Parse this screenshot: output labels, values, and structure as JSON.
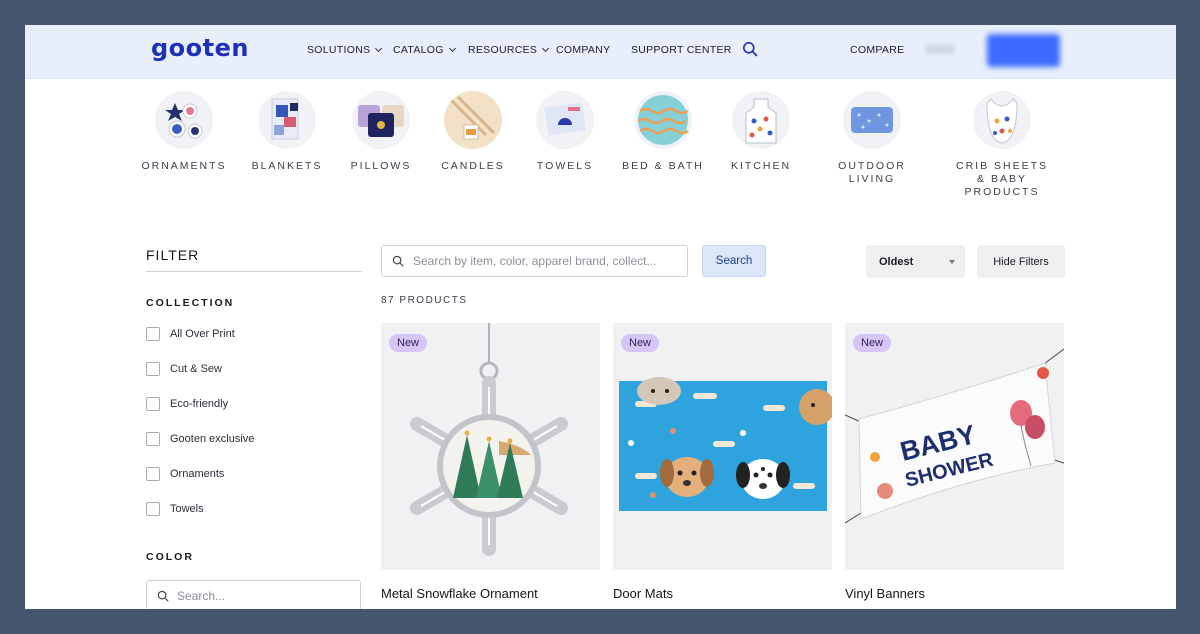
{
  "header": {
    "logo": "gooten",
    "nav": [
      {
        "label": "SOLUTIONS",
        "has_dropdown": true
      },
      {
        "label": "CATALOG",
        "has_dropdown": true
      },
      {
        "label": "RESOURCES",
        "has_dropdown": true
      },
      {
        "label": "COMPANY",
        "has_dropdown": false
      },
      {
        "label": "SUPPORT CENTER",
        "has_dropdown": false
      }
    ],
    "compare_label": "COMPARE",
    "search_icon": "search-icon"
  },
  "categories": [
    {
      "label": "ORNAMENTS"
    },
    {
      "label": "BLANKETS"
    },
    {
      "label": "PILLOWS"
    },
    {
      "label": "CANDLES"
    },
    {
      "label": "TOWELS"
    },
    {
      "label": "BED & BATH"
    },
    {
      "label": "KITCHEN"
    },
    {
      "label": "OUTDOOR LIVING"
    },
    {
      "label": "CRIB SHEETS & BABY PRODUCTS"
    }
  ],
  "filter": {
    "title": "FILTER",
    "collection_heading": "COLLECTION",
    "collection_options": [
      "All Over Print",
      "Cut & Sew",
      "Eco-friendly",
      "Gooten exclusive",
      "Ornaments",
      "Towels"
    ],
    "color_heading": "COLOR",
    "color_search_placeholder": "Search..."
  },
  "toolbar": {
    "search_placeholder": "Search by item, color, apparel brand, collect...",
    "search_button": "Search",
    "sort_value": "Oldest",
    "hide_filters": "Hide Filters",
    "product_count": "87 PRODUCTS"
  },
  "products": [
    {
      "badge": "New",
      "title": "Metal Snowflake Ornament"
    },
    {
      "badge": "New",
      "title": "Door Mats"
    },
    {
      "badge": "New",
      "title": "Vinyl Banners"
    }
  ],
  "banner_text": {
    "line1": "BABY",
    "line2": "SHOWER"
  },
  "colors": {
    "brand": "#1f2fb8",
    "header_bg": "#e8effa",
    "badge_bg": "#d6c6f7",
    "cta": "#3d6bff",
    "frame": "#46566e"
  }
}
